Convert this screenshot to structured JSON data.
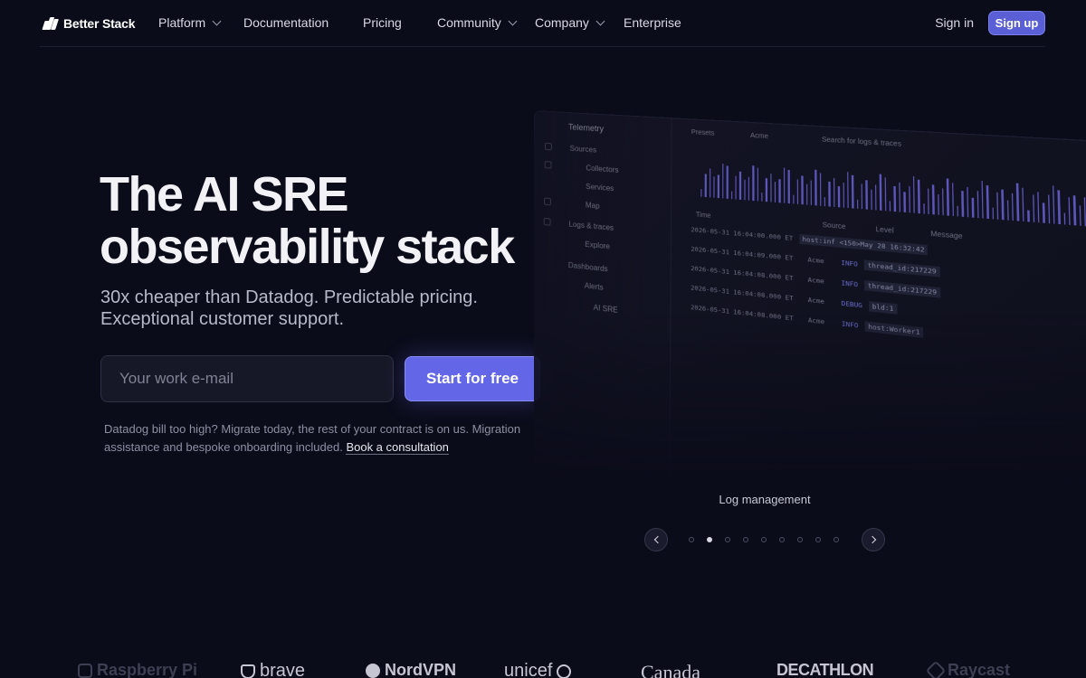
{
  "nav": {
    "logo": "Better Stack",
    "items": [
      {
        "label": "Platform",
        "dropdown": true
      },
      {
        "label": "Documentation",
        "dropdown": false
      },
      {
        "label": "Pricing",
        "dropdown": false
      },
      {
        "label": "Community",
        "dropdown": true
      },
      {
        "label": "Company",
        "dropdown": true
      },
      {
        "label": "Enterprise",
        "dropdown": false
      }
    ],
    "signin": "Sign in",
    "signup": "Sign up"
  },
  "hero": {
    "title_line1": "The AI SRE",
    "title_line2": "observability stack",
    "subtitle": "30x cheaper than Datadog. Predictable pricing. Exceptional customer support.",
    "email_placeholder": "Your work e-mail",
    "cta": "Start for free",
    "migrate_text": "Datadog bill too high? Migrate today, the rest of your contract is on us. Migration assistance and bespoke onboarding included.",
    "migrate_link": "Book a consultation"
  },
  "mock": {
    "sidebar_title": "Telemetry",
    "sidebar": [
      "Sources",
      "Collectors",
      "Services",
      "Map",
      "Logs & traces",
      "Explore",
      "Dashboards",
      "Alerts",
      "AI SRE"
    ],
    "toolbar": [
      "Presets",
      "Acme",
      "Search for logs & traces"
    ],
    "columns": [
      "Time",
      "Source",
      "Level",
      "Message"
    ],
    "rows": [
      {
        "time": "2026-05-31 16:04:00.000 ET",
        "source": "",
        "level": "",
        "msg": "host:inf <150>May 28 16:32:42"
      },
      {
        "time": "2026-05-31 16:04:09.000 ET",
        "source": "Acme",
        "level": "INFO",
        "msg": "thread_id:217229"
      },
      {
        "time": "2026-05-31 16:04:08.000 ET",
        "source": "Acme",
        "level": "INFO",
        "msg": "thread_id:217229"
      },
      {
        "time": "2026-05-31 16:04:08.000 ET",
        "source": "Acme",
        "level": "DEBUG",
        "msg": "bld:1"
      },
      {
        "time": "2026-05-31 16:04:08.000 ET",
        "source": "Acme",
        "level": "INFO",
        "msg": "host:Worker1"
      }
    ]
  },
  "carousel": {
    "caption": "Log management",
    "slide_count": 9,
    "active_index": 1
  },
  "logos": [
    "Raspberry Pi",
    "brave",
    "NordVPN",
    "unicef",
    "Canada",
    "DECATHLON",
    "Raycast"
  ],
  "colors": {
    "background": "#0b0c1a",
    "accent": "#6366e6",
    "text": "#e6e7ee"
  }
}
